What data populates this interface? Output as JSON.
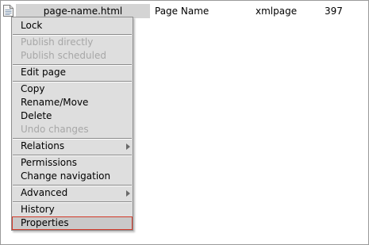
{
  "file_row": {
    "icon": "document-icon",
    "name": "page-name.html",
    "title": "Page Name",
    "type": "xmlpage",
    "size": "397"
  },
  "context_menu": {
    "items": [
      {
        "label": "Lock",
        "enabled": true
      },
      {
        "label": "Publish directly",
        "enabled": false
      },
      {
        "label": "Publish scheduled",
        "enabled": false
      },
      {
        "label": "Edit page",
        "enabled": true
      },
      {
        "label": "Copy",
        "enabled": true
      },
      {
        "label": "Rename/Move",
        "enabled": true
      },
      {
        "label": "Delete",
        "enabled": true
      },
      {
        "label": "Undo changes",
        "enabled": false
      },
      {
        "label": "Relations",
        "enabled": true,
        "submenu": true
      },
      {
        "label": "Permissions",
        "enabled": true
      },
      {
        "label": "Change navigation",
        "enabled": true
      },
      {
        "label": "Advanced",
        "enabled": true,
        "submenu": true
      },
      {
        "label": "History",
        "enabled": true
      },
      {
        "label": "Properties",
        "enabled": true,
        "selected": true
      }
    ]
  },
  "colors": {
    "menu_background": "#dedede",
    "highlight_border": "#d23a2a",
    "disabled_text": "#a7a7a7"
  }
}
